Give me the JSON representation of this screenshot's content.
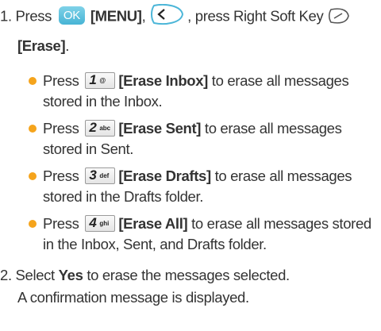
{
  "step1": {
    "number": "1.",
    "press": "Press",
    "ok_key": "OK",
    "menu": "[MENU]",
    "comma": ",",
    "nav_key_icon": "left-nav-key-icon",
    "mid": ", press Right Soft Key",
    "soft_key_icon": "right-soft-key-icon",
    "erase": "[Erase]",
    "period": "."
  },
  "bullets": [
    {
      "press": "Press",
      "key_num": "1",
      "key_sub": "@",
      "label": "[Erase Inbox]",
      "desc_1": "to erase all messages",
      "desc_2": "stored in the Inbox."
    },
    {
      "press": "Press",
      "key_num": "2",
      "key_sub": "abc",
      "label": "[Erase Sent]",
      "desc_1": "to erase all messages",
      "desc_2": "stored in Sent."
    },
    {
      "press": "Press",
      "key_num": "3",
      "key_sub": "def",
      "label": "[Erase Drafts]",
      "desc_1": "to erase all messages",
      "desc_2": "stored in the Drafts folder."
    },
    {
      "press": "Press",
      "key_num": "4",
      "key_sub": "ghi",
      "label": "[Erase All]",
      "desc_1": "to erase all messages stored",
      "desc_2": "in the Inbox, Sent, and Drafts folder."
    }
  ],
  "step2": {
    "number": "2.",
    "select": "Select",
    "yes": "Yes",
    "rest": "to erase the messages selected.",
    "line2": "A confirmation message is displayed."
  },
  "colors": {
    "bullet": "#f5a41c",
    "ok_key": "#47b4d5",
    "text": "#333333"
  }
}
